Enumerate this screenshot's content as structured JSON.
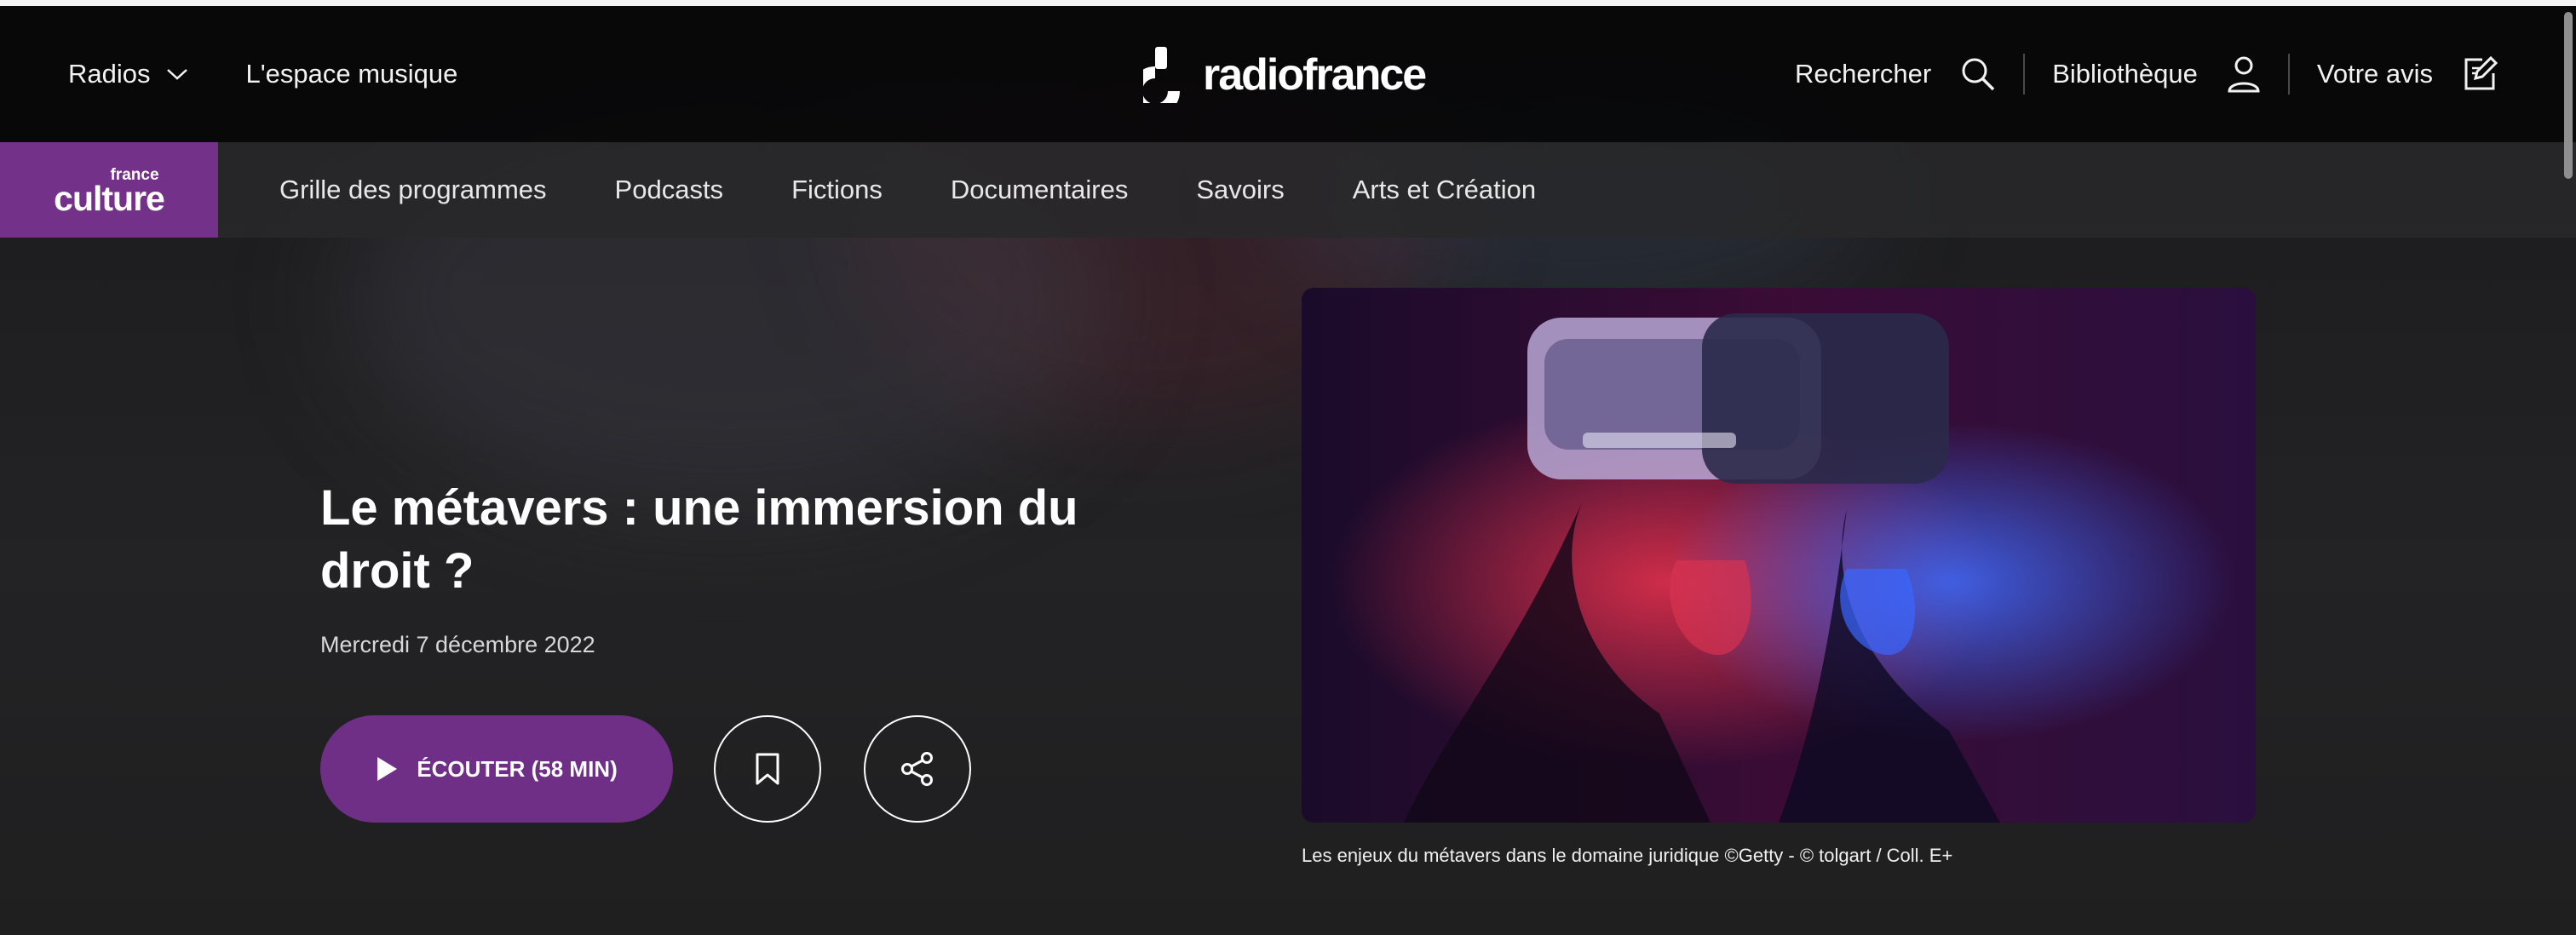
{
  "header": {
    "radios_label": "Radios",
    "music_space_label": "L'espace musique",
    "brand": "radiofrance",
    "search_label": "Rechercher",
    "library_label": "Bibliothèque",
    "feedback_label": "Votre avis"
  },
  "station": {
    "logo_small": "france",
    "logo_big": "culture",
    "accent_color": "#733189"
  },
  "subnav": {
    "items": [
      {
        "label": "Grille des programmes"
      },
      {
        "label": "Podcasts"
      },
      {
        "label": "Fictions"
      },
      {
        "label": "Documentaires"
      },
      {
        "label": "Savoirs"
      },
      {
        "label": "Arts et Création"
      }
    ]
  },
  "episode": {
    "title": "Le métavers : une immersion du droit ?",
    "date": "Mercredi 7 décembre 2022",
    "listen_label": "ÉCOUTER (58 MIN)",
    "image_caption": "Les enjeux du métavers dans le domaine juridique ©Getty - © tolgart / Coll. E+"
  },
  "icons": {
    "radios_chevron": "chevron-down-icon",
    "search": "search-icon",
    "library": "user-icon",
    "feedback": "edit-icon",
    "play": "play-icon",
    "bookmark": "bookmark-icon",
    "share": "share-icon"
  }
}
